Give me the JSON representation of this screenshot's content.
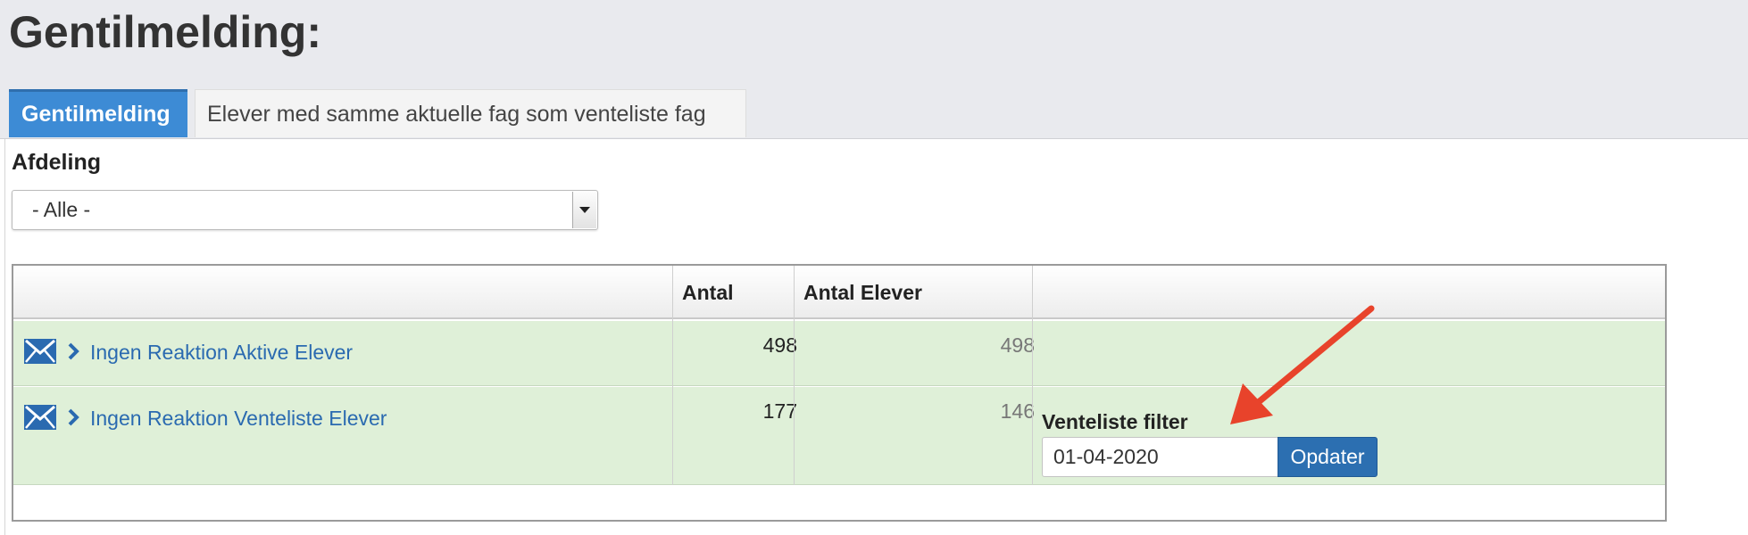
{
  "page": {
    "title": "Gentilmelding:"
  },
  "tabs": [
    {
      "label": "Gentilmelding",
      "active": true
    },
    {
      "label": "Elever med samme aktuelle fag som venteliste fag",
      "active": false
    }
  ],
  "filter": {
    "label": "Afdeling",
    "selected": "- Alle -"
  },
  "table": {
    "columns": [
      "",
      "Antal",
      "Antal Elever",
      ""
    ],
    "rows": [
      {
        "icon": "mail-icon",
        "label": "Ingen Reaktion Aktive Elever",
        "antal": "498",
        "antal_elever": "498"
      },
      {
        "icon": "mail-icon",
        "label": "Ingen Reaktion Venteliste Elever",
        "antal": "177",
        "antal_elever": "146"
      }
    ],
    "venteliste_filter": {
      "label": "Venteliste filter",
      "value": "01-04-2020",
      "button": "Opdater"
    }
  },
  "colors": {
    "tab_active": "#3d8bd5",
    "row_bg": "#dff0d8",
    "link": "#2a6ab0",
    "button": "#2c6fb1",
    "arrow": "#e8432b"
  }
}
